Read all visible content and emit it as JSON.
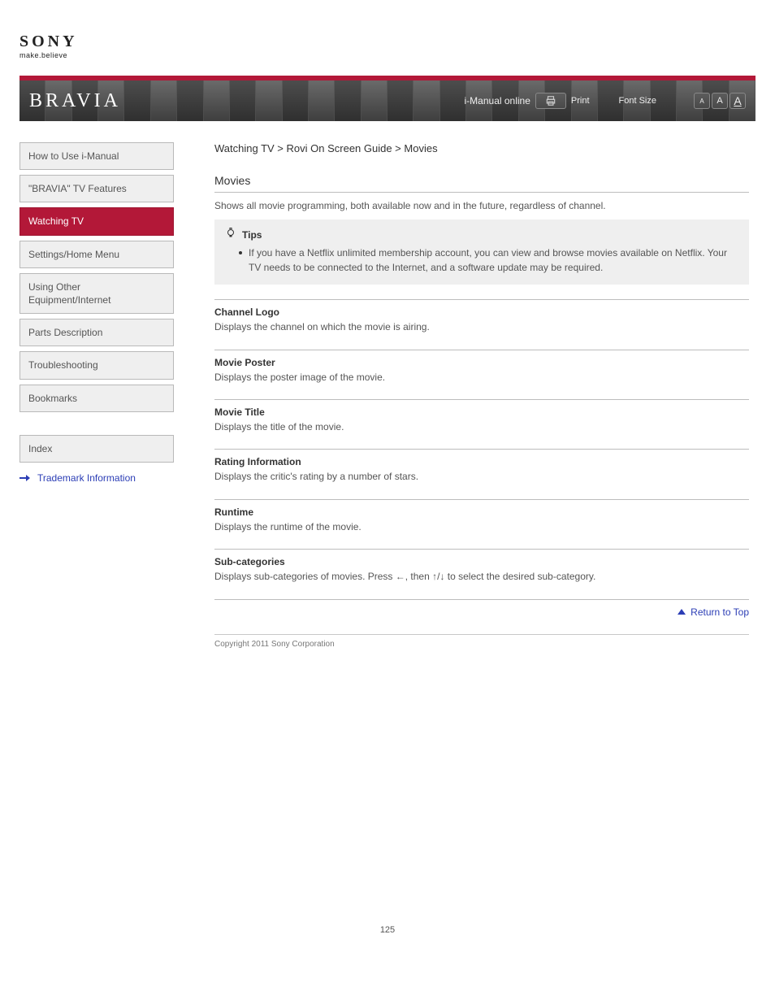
{
  "logo": {
    "brand": "SONY",
    "tagline": "make.believe"
  },
  "header": {
    "product": "BRAVIA",
    "imanual_link": "i-Manual online",
    "print_label": "Print",
    "font_btn_small": "A",
    "font_btn_med": "A",
    "font_btn_large": "A",
    "font_size_label": "Font Size"
  },
  "sidebar": {
    "items": [
      {
        "label": "How to Use i-Manual"
      },
      {
        "label": "\"BRAVIA\" TV Features"
      },
      {
        "label": "Watching TV",
        "active": true
      },
      {
        "label": "Settings/Home Menu"
      },
      {
        "label": "Using Other Equipment/Internet"
      },
      {
        "label": "Parts Description"
      },
      {
        "label": "Troubleshooting"
      },
      {
        "label": "Bookmarks"
      },
      {
        "label": "Index"
      }
    ],
    "tm_link": "Trademark Information"
  },
  "content": {
    "crumb": "Watching TV > Rovi On Screen Guide > Movies",
    "title": "Movies",
    "intro": "Shows all movie programming, both available now and in the future, regardless of channel.",
    "tips_label": "Tips",
    "tips": [
      "If you have a Netflix unlimited membership account, you can view and browse movies available on Netflix. Your TV needs to be connected to the Internet, and a software update may be required."
    ],
    "sections": [
      {
        "label": "Channel Logo",
        "body": "Displays the channel on which the movie is airing."
      },
      {
        "label": "Movie Poster",
        "body": "Displays the poster image of the movie."
      },
      {
        "label": "Movie Title",
        "body": "Displays the title of the movie."
      },
      {
        "label": "Rating Information",
        "body": "Displays the critic's rating by a number of stars."
      },
      {
        "label": "Runtime",
        "body": "Displays the runtime of the movie."
      },
      {
        "label": "Sub-categories",
        "body": "Displays sub-categories of movies. Press ←, then ↑/↓ to select the desired sub-category."
      }
    ],
    "top_link": "Return to Top"
  },
  "footer": {
    "copyright": "Copyright 2011 Sony Corporation"
  },
  "page_number": "125"
}
